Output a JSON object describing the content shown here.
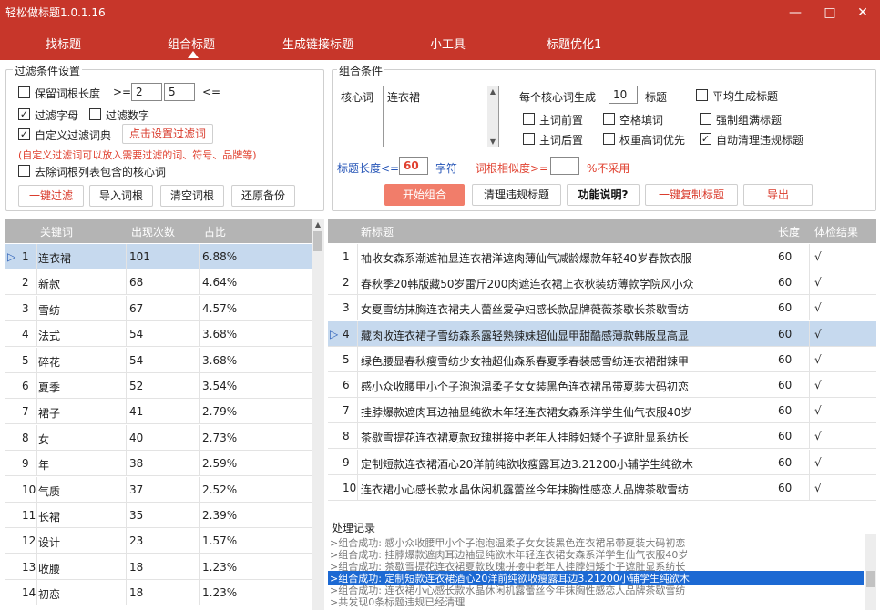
{
  "app": {
    "title": "轻松做标题1.0.1.16",
    "min": "—",
    "max": "□",
    "close": "✕"
  },
  "nav": [
    "找标题",
    "组合标题",
    "生成链接标题",
    "小工具",
    "标题优化1"
  ],
  "filter": {
    "title": "过滤条件设置",
    "keep_len": "保留词根长度",
    "ge": ">=",
    "min_len": "2",
    "max_len": "5",
    "le": "<=",
    "filter_letters": "过滤字母",
    "filter_digits": "过滤数字",
    "custom_dict": "自定义过滤词典",
    "set_filter_btn": "点击设置过滤词",
    "note": "(自定义过滤词可以放入需要过滤的词、符号、品牌等)",
    "remove_core": "去除词根列表包含的核心词",
    "buttons": [
      "一键过滤",
      "导入词根",
      "清空词根",
      "还原备份"
    ]
  },
  "combo": {
    "title": "组合条件",
    "core_label": "核心词",
    "core_value": "连衣裙",
    "per_core": "每个核心词生成",
    "per_core_val": "10",
    "titles_unit": "标题",
    "avg": "平均生成标题",
    "main_front": "主词前置",
    "space_fill": "空格填词",
    "force_full": "强制组满标题",
    "main_back": "主词后置",
    "weight_first": "权重高词优先",
    "auto_clean": "自动清理违规标题",
    "len_label": "标题长度<=",
    "len_val": "60",
    "len_unit": "字符",
    "sim_label": "词根相似度>=",
    "sim_val": "",
    "sim_note": "%不采用",
    "buttons": [
      "开始组合",
      "清理违规标题",
      "功能说明?",
      "一键复制标题",
      "导出"
    ]
  },
  "kw_table": {
    "headers": [
      "关键词",
      "出现次数",
      "占比"
    ],
    "rows": [
      [
        "1",
        "连衣裙",
        "101",
        "6.88%"
      ],
      [
        "2",
        "新款",
        "68",
        "4.64%"
      ],
      [
        "3",
        "雪纺",
        "67",
        "4.57%"
      ],
      [
        "4",
        "法式",
        "54",
        "3.68%"
      ],
      [
        "5",
        "碎花",
        "54",
        "3.68%"
      ],
      [
        "6",
        "夏季",
        "52",
        "3.54%"
      ],
      [
        "7",
        "裙子",
        "41",
        "2.79%"
      ],
      [
        "8",
        "女",
        "40",
        "2.73%"
      ],
      [
        "9",
        "年",
        "38",
        "2.59%"
      ],
      [
        "10",
        "气质",
        "37",
        "2.52%"
      ],
      [
        "11",
        "长裙",
        "35",
        "2.39%"
      ],
      [
        "12",
        "设计",
        "23",
        "1.57%"
      ],
      [
        "13",
        "收腰",
        "18",
        "1.23%"
      ],
      [
        "14",
        "初恋",
        "18",
        "1.23%"
      ]
    ],
    "selected_marker": "▷"
  },
  "title_table": {
    "headers": [
      "新标题",
      "长度",
      "体检结果"
    ],
    "rows": [
      [
        "1",
        "袖收女森系潮遮袖显连衣裙洋遮肉薄仙气减龄爆款年轻40岁春款衣服",
        "60",
        "√"
      ],
      [
        "2",
        "春秋季20韩版藏50岁雷斤200肉遮连衣裙上衣秋装纺薄款学院风小众",
        "60",
        "√"
      ],
      [
        "3",
        "女夏雪纺抹胸连衣裙夫人蕾丝爱孕妇感长款品牌薇薇茶歇长茶歇雪纺",
        "60",
        "√"
      ],
      [
        "4",
        "藏肉收连衣裙子雪纺森系露轻熟辣妹超仙显甲甜酷感薄款韩版显高显",
        "60",
        "√"
      ],
      [
        "5",
        "绿色腰显春秋瘦雪纺少女袖超仙森系春夏季春装感雪纺连衣裙甜辣甲",
        "60",
        "√"
      ],
      [
        "6",
        "感小众收腰甲小个子泡泡温柔子女女装黑色连衣裙吊带夏装大码初恋",
        "60",
        "√"
      ],
      [
        "7",
        "挂脖爆款遮肉耳边袖显纯欲木年轻连衣裙女森系洋学生仙气衣服40岁",
        "60",
        "√"
      ],
      [
        "8",
        "茶歇雪提花连衣裙夏款玫瑰拼接中老年人挂脖妇矮个子遮肚显系纺长",
        "60",
        "√"
      ],
      [
        "9",
        "定制短款连衣裙酒心20洋前纯欲收瘦露耳边3.21200小辅学生纯欲木",
        "60",
        "√"
      ],
      [
        "10",
        "连衣裙小心感长款水晶休闲机露蕾丝今年抹胸性感恋人品牌茶歇雪纺",
        "60",
        "√"
      ]
    ],
    "selected_marker": "▷"
  },
  "log": {
    "title": "处理记录",
    "lines": [
      ">组合成功: 感小众收腰甲小个子泡泡温柔子女女装黑色连衣裙吊带夏装大码初恋",
      ">组合成功: 挂脖爆款遮肉耳边袖显纯欲木年轻连衣裙女森系洋学生仙气衣服40岁",
      ">组合成功: 茶歇雪提花连衣裙夏款玫瑰拼接中老年人挂脖妇矮个子遮肚显系纺长",
      ">组合成功: 定制短款连衣裙酒心20洋前纯欲收瘦露耳边3.21200小辅学生纯欲木",
      ">组合成功: 连衣裙小心感长款水晶休闲机露蕾丝今年抹胸性感恋人品牌茶歇雪纺",
      ">共发现0条标题违规已经清理"
    ]
  }
}
